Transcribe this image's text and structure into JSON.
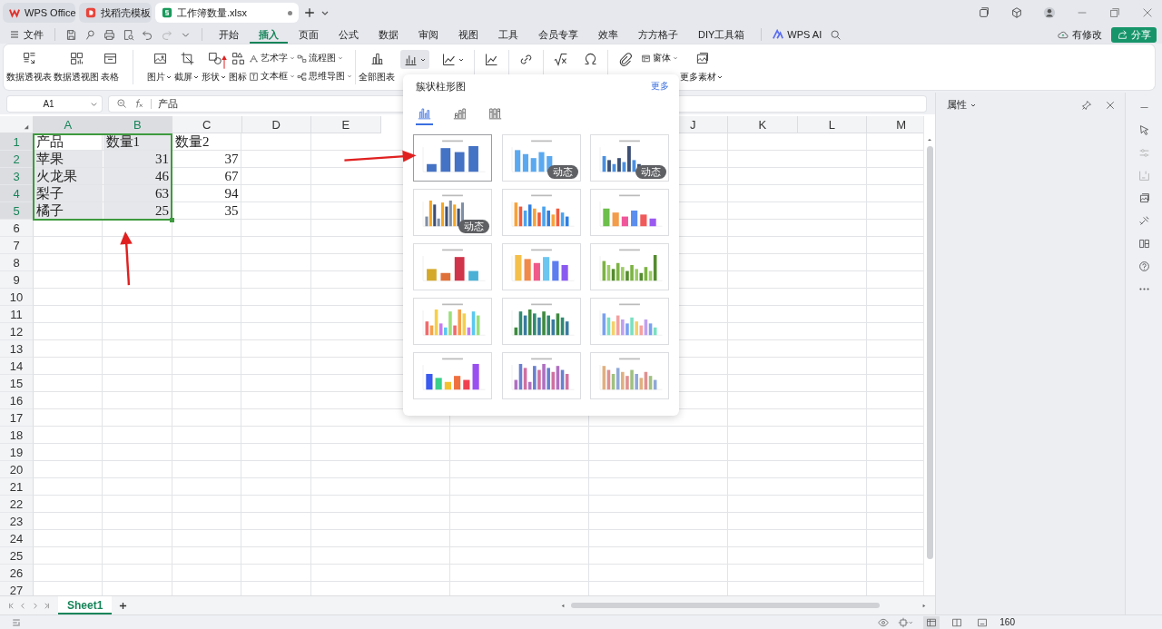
{
  "tabs": [
    {
      "label": "WPS Office",
      "selected": false,
      "kind": "home"
    },
    {
      "label": "找稻壳模板",
      "selected": false,
      "kind": "template"
    },
    {
      "label": "工作簿数量.xlsx",
      "selected": true,
      "kind": "sheet"
    }
  ],
  "file_menu": "文件",
  "menu": [
    {
      "label": "开始",
      "selected": false
    },
    {
      "label": "插入",
      "selected": true
    },
    {
      "label": "页面",
      "selected": false
    },
    {
      "label": "公式",
      "selected": false
    },
    {
      "label": "数据",
      "selected": false
    },
    {
      "label": "审阅",
      "selected": false
    },
    {
      "label": "视图",
      "selected": false
    },
    {
      "label": "工具",
      "selected": false
    },
    {
      "label": "会员专享",
      "selected": false
    },
    {
      "label": "效率",
      "selected": false
    },
    {
      "label": "方方格子",
      "selected": false
    },
    {
      "label": "DIY工具箱",
      "selected": false
    }
  ],
  "ai_button": "WPS AI",
  "modified": "有修改",
  "share": "分享",
  "ribbon": [
    {
      "kind": "big",
      "label": "数据透视表",
      "dropdown": false
    },
    {
      "kind": "big",
      "label": "数据透视图",
      "dropdown": false
    },
    {
      "kind": "big",
      "label": "表格",
      "dropdown": false
    },
    {
      "kind": "separator"
    },
    {
      "kind": "big",
      "label": "图片",
      "dropdown": true
    },
    {
      "kind": "big",
      "label": "截屏",
      "dropdown": true
    },
    {
      "kind": "big",
      "label": "形状",
      "dropdown": true
    },
    {
      "kind": "big",
      "label": "图标",
      "dropdown": false
    },
    {
      "kind": "stack",
      "items": [
        {
          "label": "艺术字",
          "dropdown": true
        },
        {
          "label": "文本框",
          "dropdown": true
        }
      ]
    },
    {
      "kind": "stack",
      "items": [
        {
          "label": "流程图",
          "dropdown": true
        },
        {
          "label": "思维导图",
          "dropdown": true
        }
      ]
    },
    {
      "kind": "separator"
    },
    {
      "kind": "big",
      "label": "全部图表",
      "dropdown": false
    },
    {
      "kind": "icon",
      "dropdown": true,
      "selected": true
    },
    {
      "kind": "icon",
      "dropdown": true,
      "selected": false
    },
    {
      "kind": "separator"
    },
    {
      "kind": "icon",
      "dropdown": false,
      "selected": false
    },
    {
      "kind": "separator"
    },
    {
      "kind": "icon",
      "dropdown": false,
      "selected": false
    },
    {
      "kind": "separator"
    },
    {
      "kind": "icon",
      "dropdown": false,
      "selected": false
    },
    {
      "kind": "icon",
      "dropdown": false,
      "selected": false
    },
    {
      "kind": "separator"
    },
    {
      "kind": "icon",
      "dropdown": false,
      "selected": false
    },
    {
      "kind": "stack",
      "items": [
        {
          "label": "窗体",
          "dropdown": true
        }
      ]
    },
    {
      "kind": "big",
      "label": "更多素材",
      "dropdown": true
    }
  ],
  "name_box": "A1",
  "formula": "产品",
  "columns": [
    {
      "label": "A",
      "selected": true
    },
    {
      "label": "B",
      "selected": true
    },
    {
      "label": "C",
      "selected": false
    },
    {
      "label": "D",
      "selected": false
    },
    {
      "label": "E",
      "selected": false
    },
    {
      "label": "J",
      "selected": false
    },
    {
      "label": "K",
      "selected": false
    },
    {
      "label": "L",
      "selected": false
    },
    {
      "label": "M",
      "selected": false
    }
  ],
  "rows": [
    {
      "number": "1",
      "selected": true,
      "cells": [
        {
          "value": "产品",
          "kind": "text",
          "selected": true
        },
        {
          "value": "数量1",
          "kind": "text",
          "selected": true
        },
        {
          "value": "数量2",
          "kind": "text",
          "selected": false
        }
      ]
    },
    {
      "number": "2",
      "selected": true,
      "cells": [
        {
          "value": "苹果",
          "kind": "text",
          "selected": true
        },
        {
          "value": "31",
          "kind": "number",
          "selected": true
        },
        {
          "value": "37",
          "kind": "number",
          "selected": false
        }
      ]
    },
    {
      "number": "3",
      "selected": true,
      "cells": [
        {
          "value": "火龙果",
          "kind": "text",
          "selected": true
        },
        {
          "value": "46",
          "kind": "number",
          "selected": true
        },
        {
          "value": "67",
          "kind": "number",
          "selected": false
        }
      ]
    },
    {
      "number": "4",
      "selected": true,
      "cells": [
        {
          "value": "梨子",
          "kind": "text",
          "selected": true
        },
        {
          "value": "63",
          "kind": "number",
          "selected": true
        },
        {
          "value": "94",
          "kind": "number",
          "selected": false
        }
      ]
    },
    {
      "number": "5",
      "selected": true,
      "cells": [
        {
          "value": "橘子",
          "kind": "text",
          "selected": true
        },
        {
          "value": "25",
          "kind": "number",
          "selected": true
        },
        {
          "value": "35",
          "kind": "number",
          "selected": false
        }
      ]
    },
    {
      "number": "6",
      "selected": false
    },
    {
      "number": "7",
      "selected": false
    },
    {
      "number": "8",
      "selected": false
    },
    {
      "number": "9",
      "selected": false
    },
    {
      "number": "10",
      "selected": false
    },
    {
      "number": "11",
      "selected": false
    },
    {
      "number": "12",
      "selected": false
    },
    {
      "number": "13",
      "selected": false
    },
    {
      "number": "14",
      "selected": false
    },
    {
      "number": "15",
      "selected": false
    },
    {
      "number": "16",
      "selected": false
    },
    {
      "number": "17",
      "selected": false
    },
    {
      "number": "18",
      "selected": false
    },
    {
      "number": "19",
      "selected": false
    },
    {
      "number": "20",
      "selected": false
    },
    {
      "number": "21",
      "selected": false
    },
    {
      "number": "22",
      "selected": false
    },
    {
      "number": "23",
      "selected": false
    },
    {
      "number": "24",
      "selected": false
    },
    {
      "number": "25",
      "selected": false
    },
    {
      "number": "26",
      "selected": false
    },
    {
      "number": "27",
      "selected": false
    }
  ],
  "chart_menu": {
    "title": "簇状柱形图",
    "more": "更多",
    "subtypes": [
      {
        "selected": true
      },
      {
        "selected": false
      },
      {
        "selected": false
      }
    ],
    "templates": [
      {
        "selected": true
      },
      {
        "selected": false,
        "badge": "动态"
      },
      {
        "selected": false,
        "badge": "动态"
      },
      {
        "selected": false,
        "badge": "动态"
      },
      {
        "selected": false
      },
      {
        "selected": false
      },
      {
        "selected": false
      },
      {
        "selected": false
      },
      {
        "selected": false
      },
      {
        "selected": false
      },
      {
        "selected": false
      },
      {
        "selected": false
      },
      {
        "selected": false
      },
      {
        "selected": false
      },
      {
        "selected": false
      }
    ]
  },
  "panel": {
    "title": "属性"
  },
  "sheets": [
    {
      "label": "Sheet1",
      "selected": true
    }
  ],
  "zoom": "160"
}
